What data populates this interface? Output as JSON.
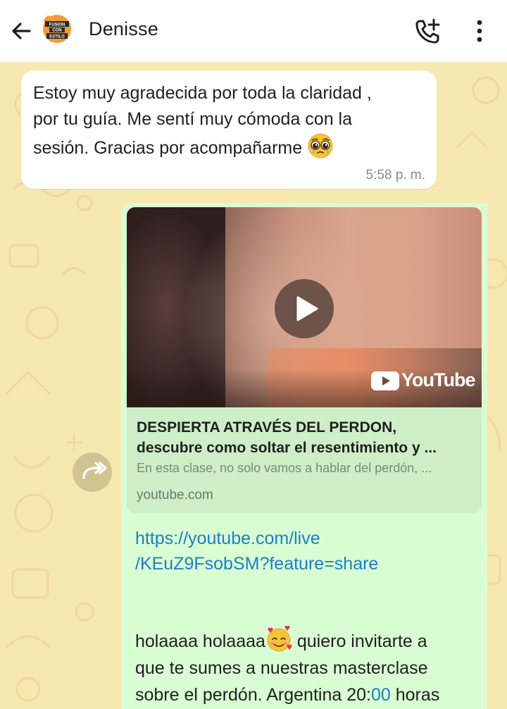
{
  "header": {
    "contact_name": "Denisse",
    "avatar_text": [
      "FUSION",
      "CON",
      "ESTILO"
    ],
    "icons": {
      "back": "arrow-left-icon",
      "call": "add-call-icon",
      "menu": "more-vertical-icon"
    }
  },
  "messages": {
    "incoming": {
      "lines": [
        "Estoy muy agradecida por toda la claridad ,",
        "por tu guía. Me sentí muy cómoda con la",
        "sesión. Gracias por acompañarme"
      ],
      "emoji": "pleading-face-emoji",
      "time": "5:58 p. m."
    },
    "outgoing": {
      "video": {
        "brand": "YouTube",
        "icon": "play-icon"
      },
      "preview": {
        "title_line1": "DESPIERTA ATRAVÉS DEL PERDON,",
        "title_line2": "descubre como soltar el resentimiento y ...",
        "description": "En esta clase, no solo vamos a hablar del perdón, ...",
        "domain": "youtube.com"
      },
      "link_line1": "https://youtube.com/live",
      "link_line2": "/KEuZ9FsobSM?feature=share",
      "text_part1": "holaaaa holaaaa",
      "emoji": "smiling-face-with-hearts-emoji",
      "text_part2": " quiero invitarte a",
      "text_line2": "que te sumes a nuestras masterclase",
      "text_line3_a": "sobre el perdón. Argentina 20:",
      "text_line3_num": "00",
      "text_line3_b": " horas"
    }
  },
  "forward_icon": "forward-icon",
  "colors": {
    "wallpaper": "#f7e7b1",
    "incoming_bubble": "#ffffff",
    "outgoing_bubble": "#d9fdd3",
    "link": "#1d7fc4"
  }
}
